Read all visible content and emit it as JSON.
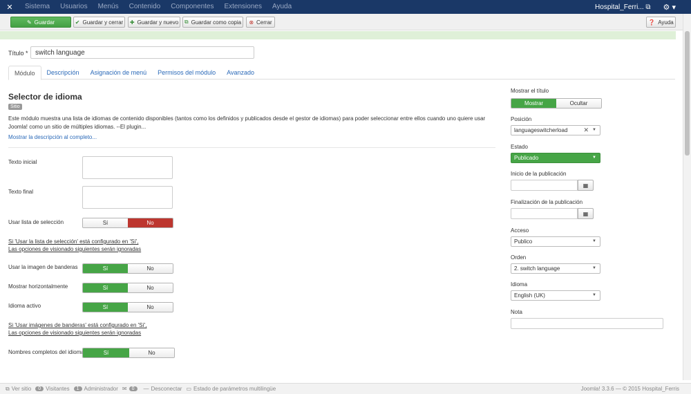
{
  "topnav": {
    "menu": [
      "Sistema",
      "Usuarios",
      "Menús",
      "Contenido",
      "Componentes",
      "Extensiones",
      "Ayuda"
    ],
    "site": "Hospital_Ferri..."
  },
  "toolbar": {
    "save": "Guardar",
    "save_close": "Guardar y cerrar",
    "save_new": "Guardar y nuevo",
    "save_copy": "Guardar como copia",
    "close": "Cerrar",
    "help": "Ayuda"
  },
  "form": {
    "title_label": "Título *",
    "title_value": "switch language"
  },
  "tabs": [
    "Módulo",
    "Descripción",
    "Asignación de menú",
    "Permisos del módulo",
    "Avanzado"
  ],
  "module": {
    "heading": "Selector de idioma",
    "badge": "Sitio",
    "description": "Este módulo muestra una lista de idiomas de contenido disponibles (tantos como los definidos y publicados desde el gestor de idiomas) para poder seleccionar entre ellos cuando uno quiere usar Joomla! como un sitio de múltiples idiomas. --El plugin...",
    "more_link": "Mostrar la descripción al completo..."
  },
  "fields": {
    "pretext": "Texto inicial",
    "posttext": "Texto final",
    "dropdown": "Usar lista de selección",
    "note1_line1": "Si 'Usar la lista de selección' está configurado en 'Sí',",
    "note1_line2": "Las opciones de visionado siguientes serán ignoradas",
    "image": "Usar la imagen de banderas",
    "inline": "Mostrar horizontalmente",
    "active": "Idioma activo",
    "note2_line1": "Si 'Usar imágenes de banderas' está configurado en 'Sí',",
    "note2_line2": "Las opciones de visionado siguientes serán ignoradas",
    "full_name": "Nombres completos del idioma",
    "yes": "Sí",
    "no": "No"
  },
  "side": {
    "show_title": "Mostrar el título",
    "show": "Mostrar",
    "hide": "Ocultar",
    "position_label": "Posición",
    "position_value": "languageswitcherload",
    "state_label": "Estado",
    "state_value": "Publicado",
    "publish_up": "Inicio de la publicación",
    "publish_down": "Finalización de la publicación",
    "access_label": "Acceso",
    "access_value": "Publico",
    "order_label": "Orden",
    "order_value": "2. switch language",
    "language_label": "Idioma",
    "language_value": "English (UK)",
    "note_label": "Nota"
  },
  "status": {
    "view_site": "Ver sitio",
    "visitors_count": "0",
    "visitors": "Visitantes",
    "admin_count": "1",
    "admin": "Administrador",
    "messages_count": "0",
    "logout": "Desconectar",
    "multilang": "Estado de parámetros multilingüe",
    "version": "Joomla! 3.3.6 — © 2015 Hospital_Ferris"
  }
}
